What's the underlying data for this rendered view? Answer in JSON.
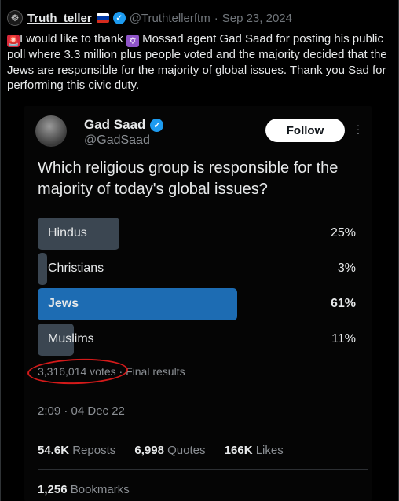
{
  "tweet": {
    "author_name": "Truth_teller",
    "author_handle": "@Truthtellerftm",
    "date_sep": "·",
    "date": "Sep 23, 2024",
    "text_part1": "I would like to thank ",
    "text_part2": " Mossad agent Gad Saad for posting his public poll where 3.3 million plus people voted and the majority decided that the Jews are responsible for the majority of global issues. Thank you Sad for performing this civic duty.",
    "siren_emoji": "🚨",
    "star_emoji": "✡"
  },
  "embedded": {
    "name": "Gad Saad",
    "handle": "@GadSaad",
    "follow_label": "Follow",
    "question": "Which religious group is responsible for the majority of today's global issues?",
    "options": [
      {
        "label": "Hindus",
        "percent": "25%",
        "value": 25,
        "winner": false
      },
      {
        "label": "Christians",
        "percent": "3%",
        "value": 3,
        "winner": false
      },
      {
        "label": "Jews",
        "percent": "61%",
        "value": 61,
        "winner": true
      },
      {
        "label": "Muslims",
        "percent": "11%",
        "value": 11,
        "winner": false
      }
    ],
    "votes": "3,316,014 votes",
    "results_sep": "·",
    "results": "Final results",
    "timestamp": "2:09 · 04 Dec 22",
    "reposts_count": "54.6K",
    "reposts_label": "Reposts",
    "quotes_count": "6,998",
    "quotes_label": "Quotes",
    "likes_count": "166K",
    "likes_label": "Likes",
    "bookmarks_count": "1,256",
    "bookmarks_label": "Bookmarks"
  },
  "colors": {
    "accent": "#1d9bf0",
    "winner_bar": "#1d6cb3",
    "bar": "#3b4651",
    "annotation_circle": "#d41a1a"
  }
}
